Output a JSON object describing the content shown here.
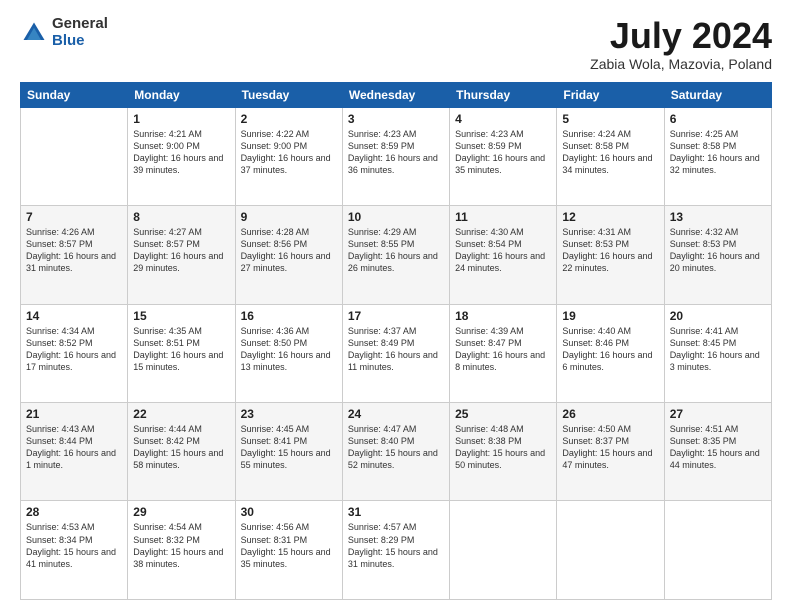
{
  "logo": {
    "general": "General",
    "blue": "Blue"
  },
  "title": "July 2024",
  "location": "Zabia Wola, Mazovia, Poland",
  "days_of_week": [
    "Sunday",
    "Monday",
    "Tuesday",
    "Wednesday",
    "Thursday",
    "Friday",
    "Saturday"
  ],
  "weeks": [
    [
      {
        "day": "",
        "sunrise": "",
        "sunset": "",
        "daylight": ""
      },
      {
        "day": "1",
        "sunrise": "Sunrise: 4:21 AM",
        "sunset": "Sunset: 9:00 PM",
        "daylight": "Daylight: 16 hours and 39 minutes."
      },
      {
        "day": "2",
        "sunrise": "Sunrise: 4:22 AM",
        "sunset": "Sunset: 9:00 PM",
        "daylight": "Daylight: 16 hours and 37 minutes."
      },
      {
        "day": "3",
        "sunrise": "Sunrise: 4:23 AM",
        "sunset": "Sunset: 8:59 PM",
        "daylight": "Daylight: 16 hours and 36 minutes."
      },
      {
        "day": "4",
        "sunrise": "Sunrise: 4:23 AM",
        "sunset": "Sunset: 8:59 PM",
        "daylight": "Daylight: 16 hours and 35 minutes."
      },
      {
        "day": "5",
        "sunrise": "Sunrise: 4:24 AM",
        "sunset": "Sunset: 8:58 PM",
        "daylight": "Daylight: 16 hours and 34 minutes."
      },
      {
        "day": "6",
        "sunrise": "Sunrise: 4:25 AM",
        "sunset": "Sunset: 8:58 PM",
        "daylight": "Daylight: 16 hours and 32 minutes."
      }
    ],
    [
      {
        "day": "7",
        "sunrise": "Sunrise: 4:26 AM",
        "sunset": "Sunset: 8:57 PM",
        "daylight": "Daylight: 16 hours and 31 minutes."
      },
      {
        "day": "8",
        "sunrise": "Sunrise: 4:27 AM",
        "sunset": "Sunset: 8:57 PM",
        "daylight": "Daylight: 16 hours and 29 minutes."
      },
      {
        "day": "9",
        "sunrise": "Sunrise: 4:28 AM",
        "sunset": "Sunset: 8:56 PM",
        "daylight": "Daylight: 16 hours and 27 minutes."
      },
      {
        "day": "10",
        "sunrise": "Sunrise: 4:29 AM",
        "sunset": "Sunset: 8:55 PM",
        "daylight": "Daylight: 16 hours and 26 minutes."
      },
      {
        "day": "11",
        "sunrise": "Sunrise: 4:30 AM",
        "sunset": "Sunset: 8:54 PM",
        "daylight": "Daylight: 16 hours and 24 minutes."
      },
      {
        "day": "12",
        "sunrise": "Sunrise: 4:31 AM",
        "sunset": "Sunset: 8:53 PM",
        "daylight": "Daylight: 16 hours and 22 minutes."
      },
      {
        "day": "13",
        "sunrise": "Sunrise: 4:32 AM",
        "sunset": "Sunset: 8:53 PM",
        "daylight": "Daylight: 16 hours and 20 minutes."
      }
    ],
    [
      {
        "day": "14",
        "sunrise": "Sunrise: 4:34 AM",
        "sunset": "Sunset: 8:52 PM",
        "daylight": "Daylight: 16 hours and 17 minutes."
      },
      {
        "day": "15",
        "sunrise": "Sunrise: 4:35 AM",
        "sunset": "Sunset: 8:51 PM",
        "daylight": "Daylight: 16 hours and 15 minutes."
      },
      {
        "day": "16",
        "sunrise": "Sunrise: 4:36 AM",
        "sunset": "Sunset: 8:50 PM",
        "daylight": "Daylight: 16 hours and 13 minutes."
      },
      {
        "day": "17",
        "sunrise": "Sunrise: 4:37 AM",
        "sunset": "Sunset: 8:49 PM",
        "daylight": "Daylight: 16 hours and 11 minutes."
      },
      {
        "day": "18",
        "sunrise": "Sunrise: 4:39 AM",
        "sunset": "Sunset: 8:47 PM",
        "daylight": "Daylight: 16 hours and 8 minutes."
      },
      {
        "day": "19",
        "sunrise": "Sunrise: 4:40 AM",
        "sunset": "Sunset: 8:46 PM",
        "daylight": "Daylight: 16 hours and 6 minutes."
      },
      {
        "day": "20",
        "sunrise": "Sunrise: 4:41 AM",
        "sunset": "Sunset: 8:45 PM",
        "daylight": "Daylight: 16 hours and 3 minutes."
      }
    ],
    [
      {
        "day": "21",
        "sunrise": "Sunrise: 4:43 AM",
        "sunset": "Sunset: 8:44 PM",
        "daylight": "Daylight: 16 hours and 1 minute."
      },
      {
        "day": "22",
        "sunrise": "Sunrise: 4:44 AM",
        "sunset": "Sunset: 8:42 PM",
        "daylight": "Daylight: 15 hours and 58 minutes."
      },
      {
        "day": "23",
        "sunrise": "Sunrise: 4:45 AM",
        "sunset": "Sunset: 8:41 PM",
        "daylight": "Daylight: 15 hours and 55 minutes."
      },
      {
        "day": "24",
        "sunrise": "Sunrise: 4:47 AM",
        "sunset": "Sunset: 8:40 PM",
        "daylight": "Daylight: 15 hours and 52 minutes."
      },
      {
        "day": "25",
        "sunrise": "Sunrise: 4:48 AM",
        "sunset": "Sunset: 8:38 PM",
        "daylight": "Daylight: 15 hours and 50 minutes."
      },
      {
        "day": "26",
        "sunrise": "Sunrise: 4:50 AM",
        "sunset": "Sunset: 8:37 PM",
        "daylight": "Daylight: 15 hours and 47 minutes."
      },
      {
        "day": "27",
        "sunrise": "Sunrise: 4:51 AM",
        "sunset": "Sunset: 8:35 PM",
        "daylight": "Daylight: 15 hours and 44 minutes."
      }
    ],
    [
      {
        "day": "28",
        "sunrise": "Sunrise: 4:53 AM",
        "sunset": "Sunset: 8:34 PM",
        "daylight": "Daylight: 15 hours and 41 minutes."
      },
      {
        "day": "29",
        "sunrise": "Sunrise: 4:54 AM",
        "sunset": "Sunset: 8:32 PM",
        "daylight": "Daylight: 15 hours and 38 minutes."
      },
      {
        "day": "30",
        "sunrise": "Sunrise: 4:56 AM",
        "sunset": "Sunset: 8:31 PM",
        "daylight": "Daylight: 15 hours and 35 minutes."
      },
      {
        "day": "31",
        "sunrise": "Sunrise: 4:57 AM",
        "sunset": "Sunset: 8:29 PM",
        "daylight": "Daylight: 15 hours and 31 minutes."
      },
      {
        "day": "",
        "sunrise": "",
        "sunset": "",
        "daylight": ""
      },
      {
        "day": "",
        "sunrise": "",
        "sunset": "",
        "daylight": ""
      },
      {
        "day": "",
        "sunrise": "",
        "sunset": "",
        "daylight": ""
      }
    ]
  ]
}
